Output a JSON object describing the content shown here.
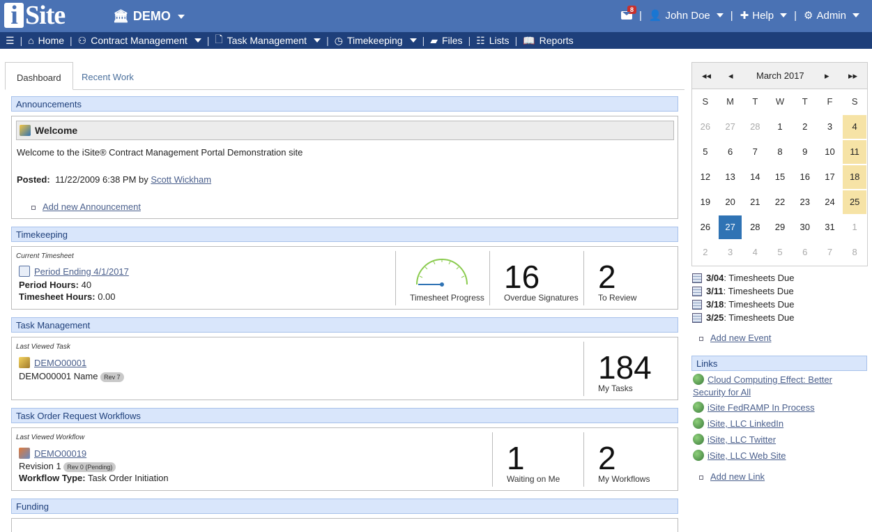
{
  "header": {
    "logo": "iSite",
    "site": "DEMO",
    "mail_count": "8",
    "user": "John Doe",
    "help": "Help",
    "admin": "Admin"
  },
  "nav": {
    "home": "Home",
    "contract": "Contract Management",
    "task": "Task Management",
    "timekeeping": "Timekeeping",
    "files": "Files",
    "lists": "Lists",
    "reports": "Reports"
  },
  "tabs": {
    "dashboard": "Dashboard",
    "recent": "Recent Work"
  },
  "announcements": {
    "title": "Announcements",
    "heading": "Welcome",
    "body": "Welcome to the iSite® Contract Management Portal Demonstration site",
    "posted_label": "Posted:",
    "posted_date": "11/22/2009 6:38 PM by",
    "author": "Scott Wickham",
    "add": "Add new Announcement"
  },
  "timekeeping": {
    "title": "Timekeeping",
    "current_label": "Current Timesheet",
    "period_link": "Period Ending 4/1/2017",
    "period_hours_label": "Period Hours:",
    "period_hours": "40",
    "sheet_hours_label": "Timesheet Hours:",
    "sheet_hours": "0.00",
    "progress_caption": "Timesheet Progress",
    "progress_value": 0,
    "overdue": "16",
    "overdue_caption": "Overdue Signatures",
    "review": "2",
    "review_caption": "To Review"
  },
  "task": {
    "title": "Task Management",
    "last_label": "Last Viewed Task",
    "task_link": "DEMO00001",
    "task_name": "DEMO00001 Name",
    "rev": "Rev 7",
    "count": "184",
    "count_caption": "My Tasks"
  },
  "workflow": {
    "title": "Task Order Request Workflows",
    "last_label": "Last Viewed Workflow",
    "link": "DEMO00019",
    "revision": "Revision 1",
    "rev_badge": "Rev 0 (Pending)",
    "type_label": "Workflow Type:",
    "type": "Task Order Initiation",
    "waiting": "1",
    "waiting_caption": "Waiting on Me",
    "mine": "2",
    "mine_caption": "My Workflows"
  },
  "funding": {
    "title": "Funding"
  },
  "calendar": {
    "month": "March 2017",
    "dow": [
      "S",
      "M",
      "T",
      "W",
      "T",
      "F",
      "S"
    ],
    "weeks": [
      [
        "26",
        "27",
        "28",
        "1",
        "2",
        "3",
        "4"
      ],
      [
        "5",
        "6",
        "7",
        "8",
        "9",
        "10",
        "11"
      ],
      [
        "12",
        "13",
        "14",
        "15",
        "16",
        "17",
        "18"
      ],
      [
        "19",
        "20",
        "21",
        "22",
        "23",
        "24",
        "25"
      ],
      [
        "26",
        "27",
        "28",
        "29",
        "30",
        "31",
        "1"
      ],
      [
        "2",
        "3",
        "4",
        "5",
        "6",
        "7",
        "8"
      ]
    ]
  },
  "events": [
    {
      "date": "3/04",
      "text": ": Timesheets Due"
    },
    {
      "date": "3/11",
      "text": ": Timesheets Due"
    },
    {
      "date": "3/18",
      "text": ": Timesheets Due"
    },
    {
      "date": "3/25",
      "text": ": Timesheets Due"
    }
  ],
  "add_event": "Add new Event",
  "links": {
    "title": "Links",
    "items": [
      "Cloud Computing Effect: Better Security for All",
      "iSite FedRAMP In Process",
      "iSite, LLC LinkedIn",
      "iSite, LLC Twitter",
      "iSite, LLC Web Site"
    ],
    "add": "Add new Link"
  },
  "colors": {
    "header": "#4a72b4",
    "nav": "#1e3f7a",
    "accent": "#2f73b4"
  }
}
